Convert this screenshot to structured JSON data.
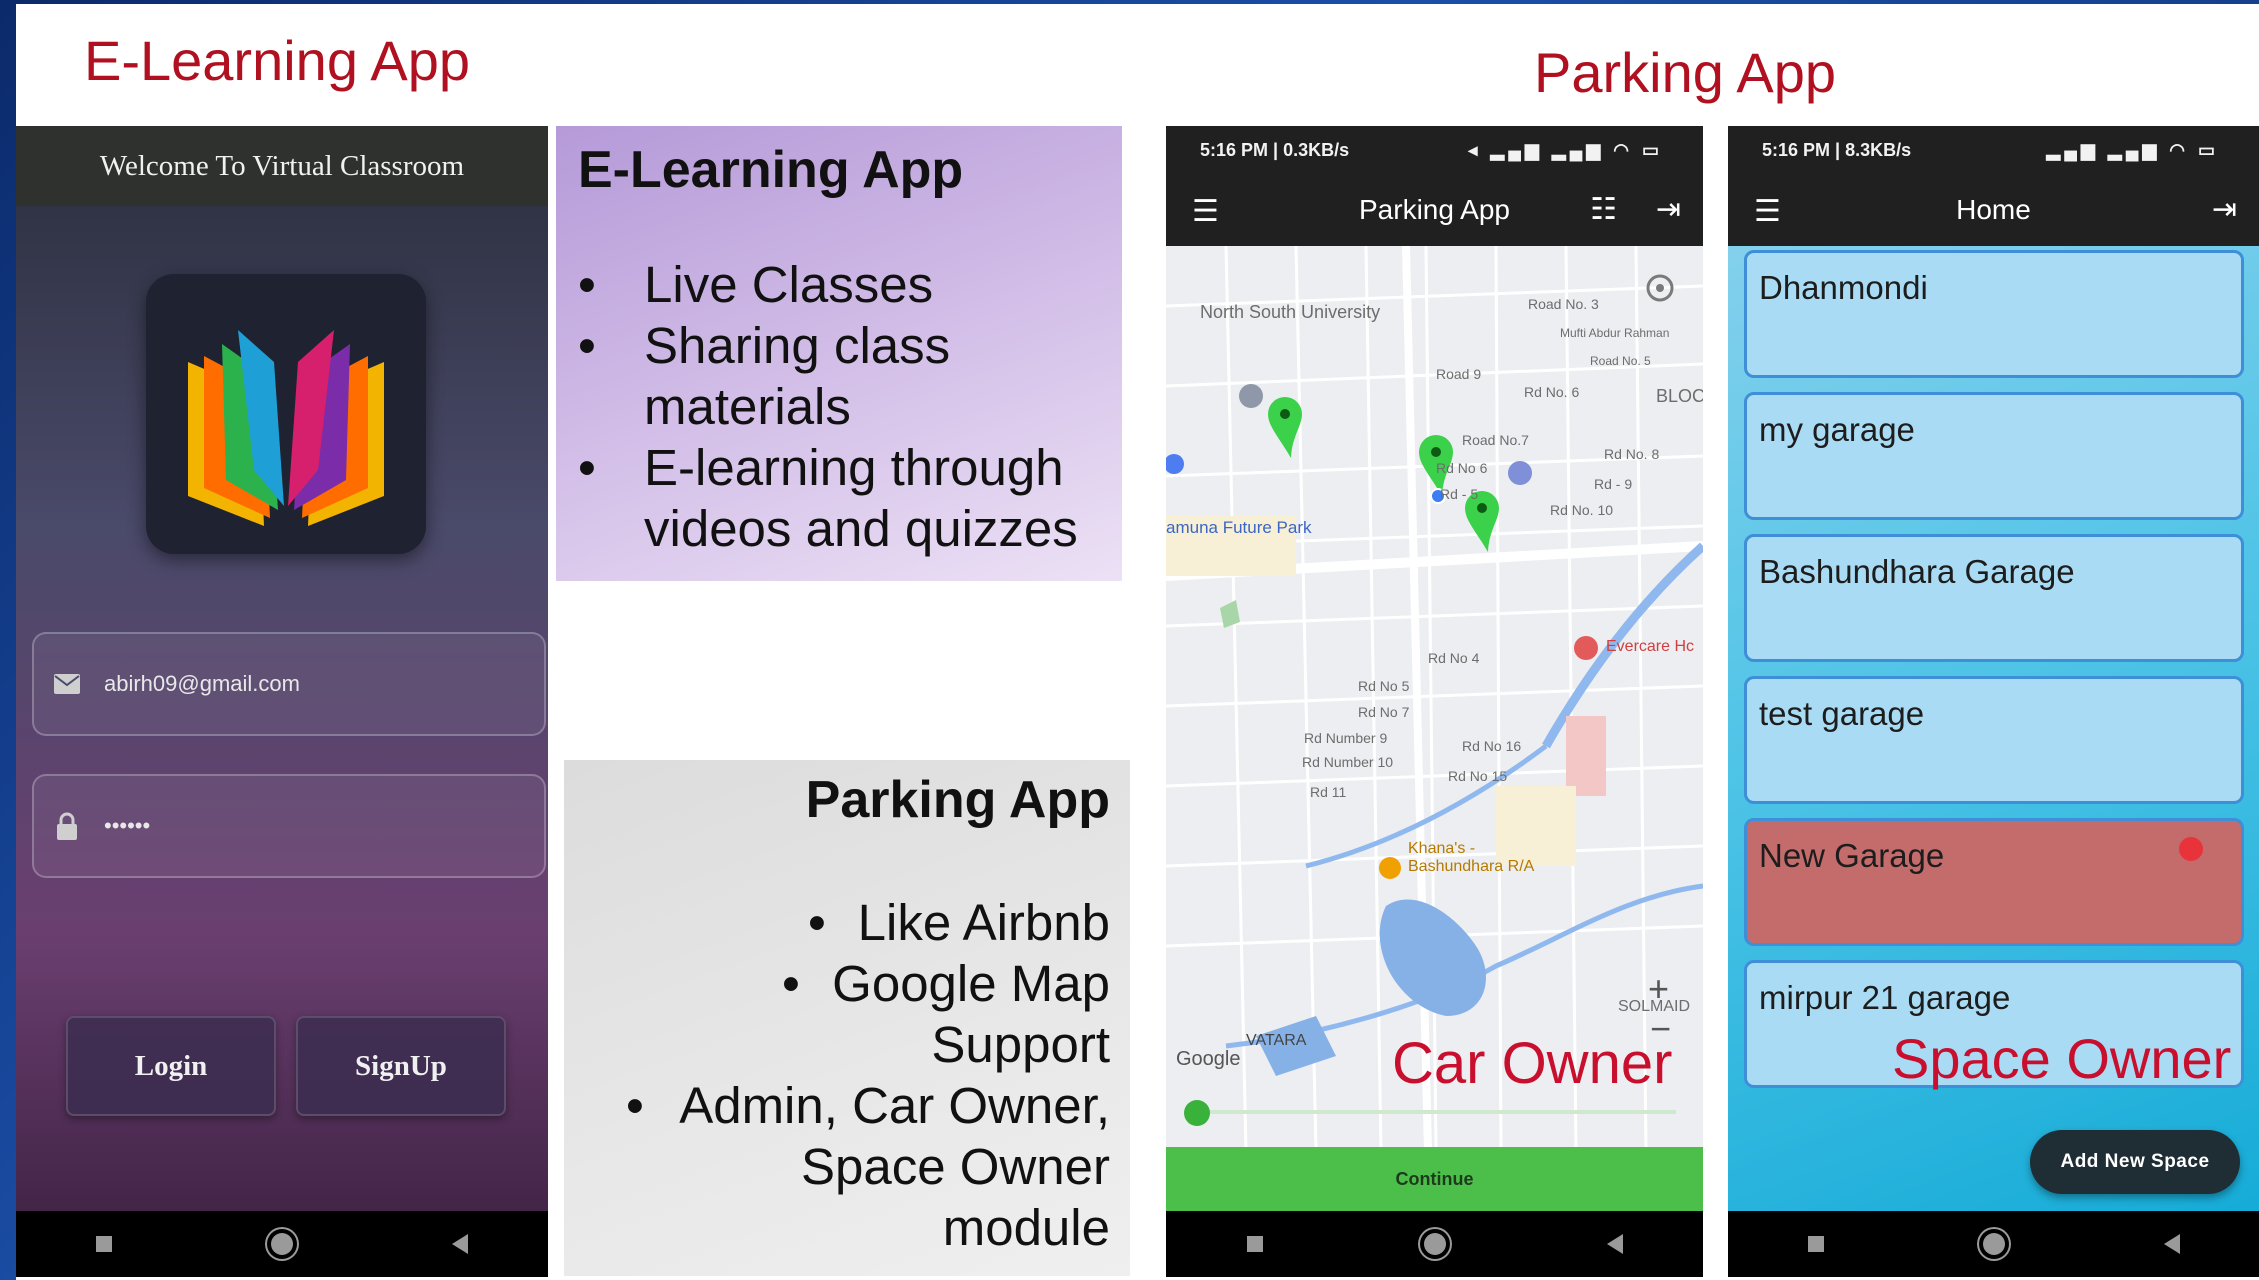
{
  "headings": {
    "elearning": "E-Learning App",
    "parking": "Parking App"
  },
  "elearning_phone": {
    "top_title": "Welcome To Virtual Classroom",
    "email_value": "abirh09@gmail.com",
    "password_value": "••••••",
    "login_label": "Login",
    "signup_label": "SignUp",
    "icons": [
      "mail-icon",
      "lock-icon",
      "book-logo-icon"
    ]
  },
  "elearning_box": {
    "title": "E-Learning App",
    "bullets": [
      "Live Classes",
      "Sharing class materials",
      "E-learning through videos and quizzes"
    ]
  },
  "parking_box": {
    "title": "Parking App",
    "bullets": [
      "Like Airbnb",
      "Google Map Support",
      "Admin, Car Owner, Space Owner module"
    ]
  },
  "map_phone": {
    "status_left": "5:16 PM | 0.3KB/s",
    "app_title": "Parking App",
    "continue_label": "Continue",
    "overlay": "Car Owner",
    "map_labels": [
      "North South University",
      "Road No. 3",
      "Road 9",
      "Rd No. 6",
      "BLOC",
      "Road No.7",
      "Rd No. 8",
      "Rd No 6",
      "Rd - 5",
      "Rd - 9",
      "Rd No. 10",
      "amuna Future Park",
      "Rd No 4",
      "Rd No 5",
      "Rd No 7",
      "Evercare Hc",
      "Rd Number 9",
      "Rd Number 10",
      "Rd No 16",
      "Rd No 15",
      "Rd 11",
      "Khana's - Bashundhara R/A",
      "VATARA",
      "SOLMAID",
      "Google",
      "Mufti Abdur Rahman",
      "Road No. 5"
    ]
  },
  "home_phone": {
    "status_left": "5:16 PM | 8.3KB/s",
    "app_title": "Home",
    "garages": [
      "Dhanmondi",
      "my garage",
      "Bashundhara Garage",
      "test garage",
      "New Garage",
      "mirpur 21 garage"
    ],
    "overlay": "Space Owner",
    "fab_label": "Add New Space"
  },
  "colors": {
    "heading_red": "#b0101f",
    "overlay_red": "#c8102e",
    "continue_green": "#4cbf4a",
    "card_blue": "#a9dcf4",
    "card_red": "#c46c6c"
  }
}
